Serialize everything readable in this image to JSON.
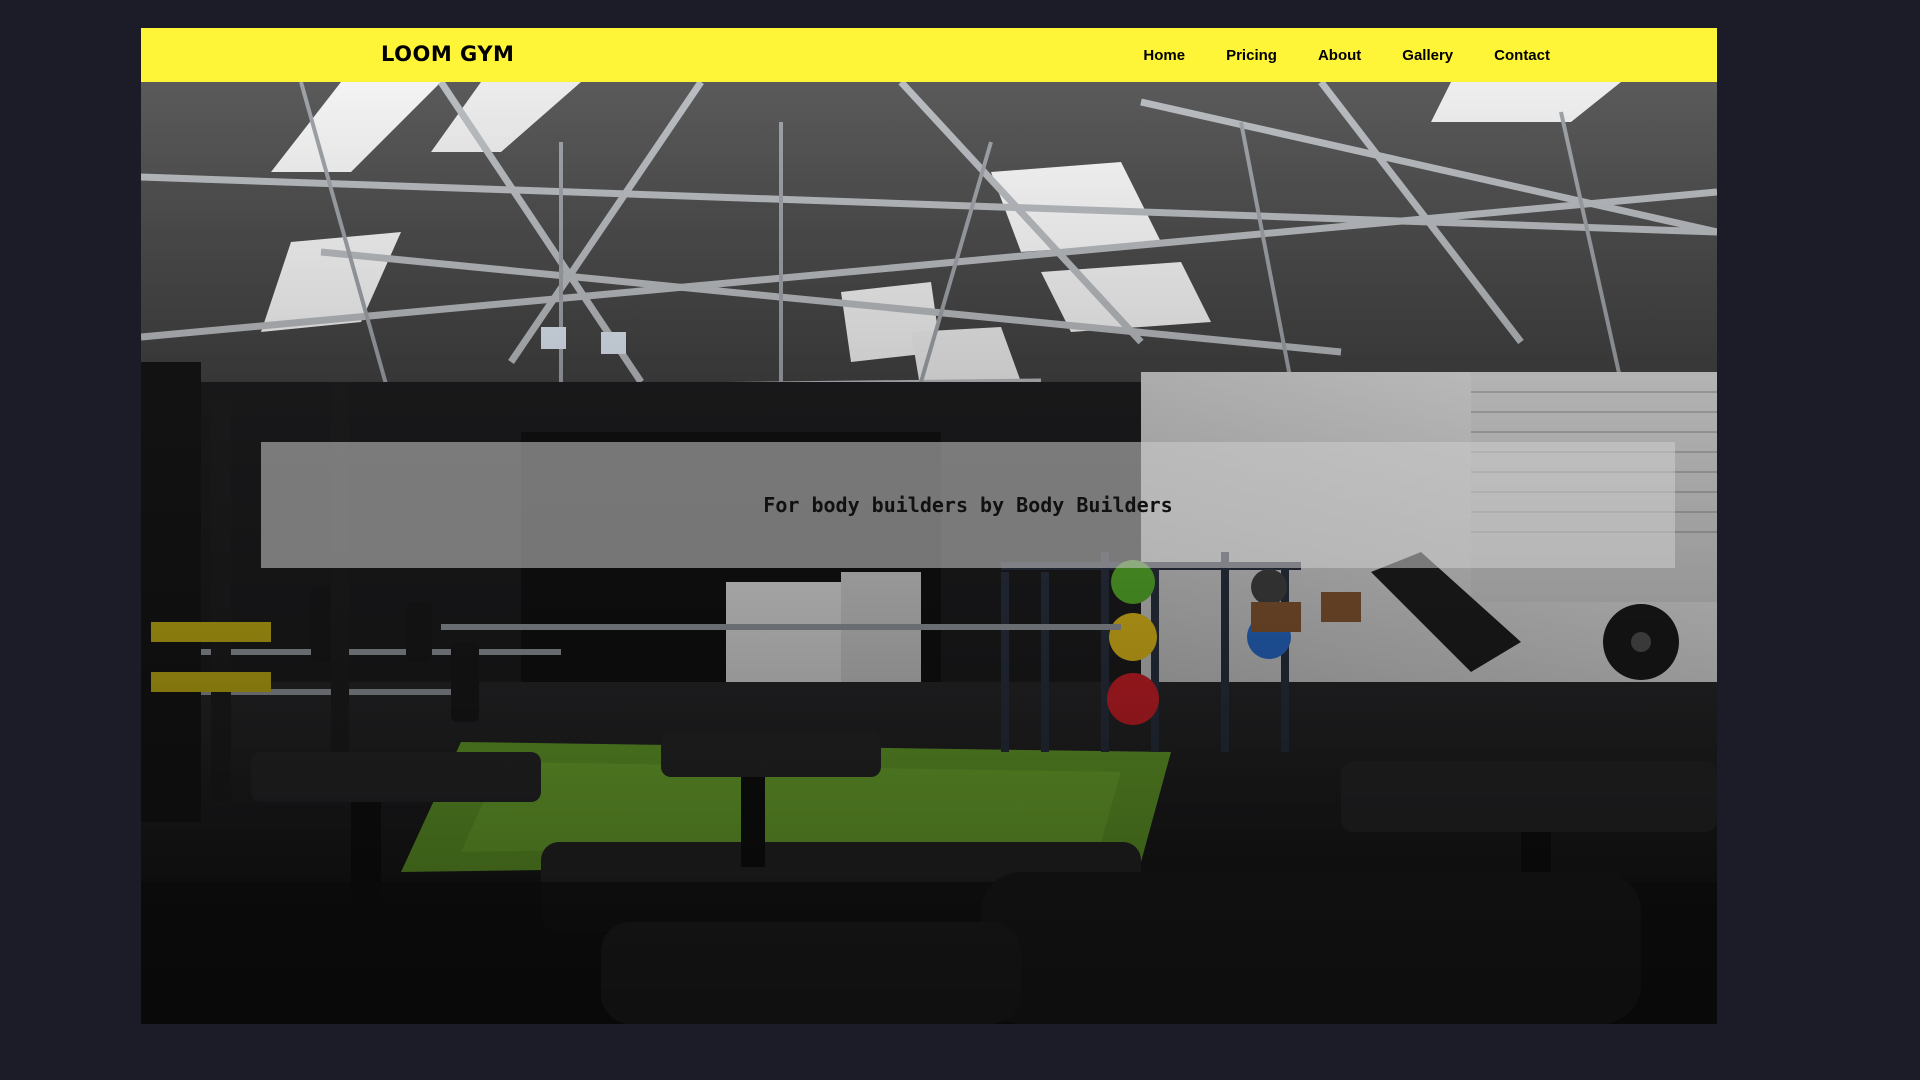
{
  "brand": {
    "name": "LOOM GYM"
  },
  "nav": {
    "items": [
      {
        "label": "Home"
      },
      {
        "label": "Pricing"
      },
      {
        "label": "About"
      },
      {
        "label": "Gallery"
      },
      {
        "label": "Contact"
      }
    ]
  },
  "hero": {
    "tagline": "For body builders by Body Builders",
    "image_description_icon": "gym-interior-photo"
  },
  "colors": {
    "navbar": "#fff538",
    "page_background": "#1c1c28",
    "tagline_box": "rgba(205,205,205,0.55)"
  }
}
